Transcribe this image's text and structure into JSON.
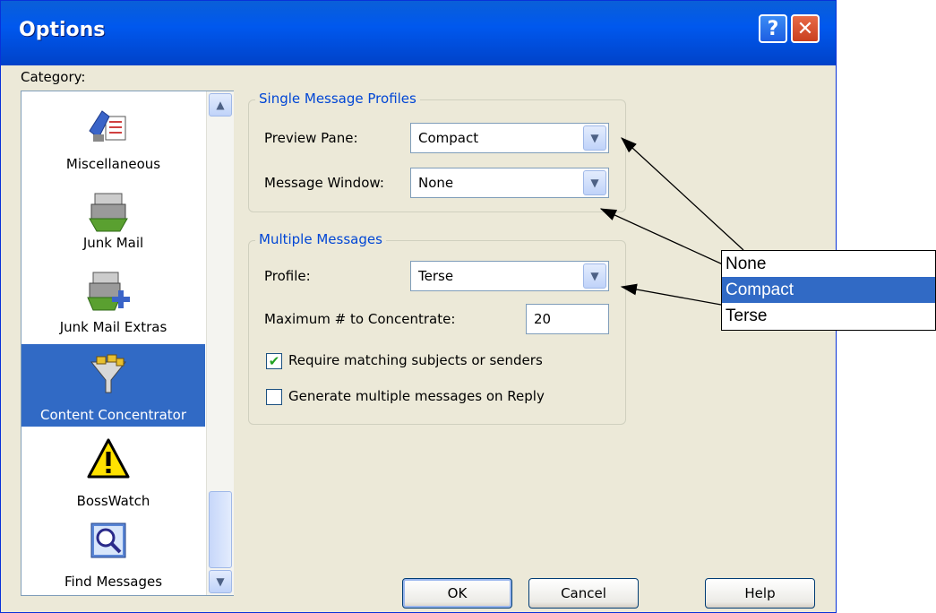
{
  "window": {
    "title": "Options",
    "help_glyph": "?",
    "close_glyph": "✕"
  },
  "category": {
    "label": "Category:",
    "items": [
      {
        "label": "Miscellaneous",
        "icon": "miscellaneous-icon"
      },
      {
        "label": "Junk Mail",
        "icon": "junk-mail-icon"
      },
      {
        "label": "Junk Mail Extras",
        "icon": "junk-mail-extras-icon"
      },
      {
        "label": "Content Concentrator",
        "icon": "funnel-icon",
        "selected": true
      },
      {
        "label": "BossWatch",
        "icon": "warning-icon"
      },
      {
        "label": "Find Messages",
        "icon": "magnifier-icon"
      }
    ]
  },
  "single": {
    "title": "Single Message Profiles",
    "preview_label": "Preview Pane:",
    "preview_value": "Compact",
    "window_label": "Message Window:",
    "window_value": "None"
  },
  "multiple": {
    "title": "Multiple Messages",
    "profile_label": "Profile:",
    "profile_value": "Terse",
    "max_label": "Maximum # to Concentrate:",
    "max_value": "20",
    "require_label": "Require matching subjects or senders",
    "require_checked": true,
    "generate_label": "Generate multiple messages on Reply",
    "generate_checked": false
  },
  "buttons": {
    "ok": "OK",
    "cancel": "Cancel",
    "help": "Help"
  },
  "popup": {
    "options": [
      "None",
      "Compact",
      "Terse"
    ],
    "selected": "Compact"
  },
  "colors": {
    "title_bar": "#0058ee",
    "selection": "#316ac5",
    "group_title": "#0046d5",
    "dialog_bg": "#ece9d8"
  }
}
